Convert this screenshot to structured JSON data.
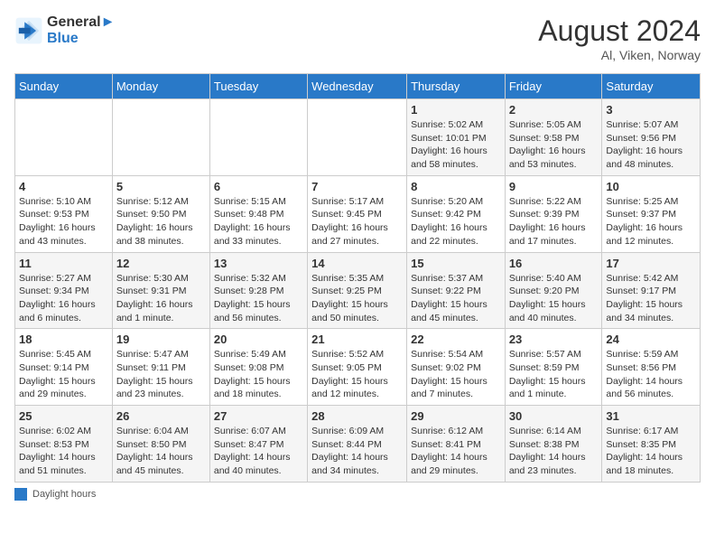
{
  "header": {
    "logo_line1": "General",
    "logo_line2": "Blue",
    "month_title": "August 2024",
    "location": "Al, Viken, Norway"
  },
  "days_of_week": [
    "Sunday",
    "Monday",
    "Tuesday",
    "Wednesday",
    "Thursday",
    "Friday",
    "Saturday"
  ],
  "weeks": [
    [
      {
        "day": "",
        "info": ""
      },
      {
        "day": "",
        "info": ""
      },
      {
        "day": "",
        "info": ""
      },
      {
        "day": "",
        "info": ""
      },
      {
        "day": "1",
        "info": "Sunrise: 5:02 AM\nSunset: 10:01 PM\nDaylight: 16 hours\nand 58 minutes."
      },
      {
        "day": "2",
        "info": "Sunrise: 5:05 AM\nSunset: 9:58 PM\nDaylight: 16 hours\nand 53 minutes."
      },
      {
        "day": "3",
        "info": "Sunrise: 5:07 AM\nSunset: 9:56 PM\nDaylight: 16 hours\nand 48 minutes."
      }
    ],
    [
      {
        "day": "4",
        "info": "Sunrise: 5:10 AM\nSunset: 9:53 PM\nDaylight: 16 hours\nand 43 minutes."
      },
      {
        "day": "5",
        "info": "Sunrise: 5:12 AM\nSunset: 9:50 PM\nDaylight: 16 hours\nand 38 minutes."
      },
      {
        "day": "6",
        "info": "Sunrise: 5:15 AM\nSunset: 9:48 PM\nDaylight: 16 hours\nand 33 minutes."
      },
      {
        "day": "7",
        "info": "Sunrise: 5:17 AM\nSunset: 9:45 PM\nDaylight: 16 hours\nand 27 minutes."
      },
      {
        "day": "8",
        "info": "Sunrise: 5:20 AM\nSunset: 9:42 PM\nDaylight: 16 hours\nand 22 minutes."
      },
      {
        "day": "9",
        "info": "Sunrise: 5:22 AM\nSunset: 9:39 PM\nDaylight: 16 hours\nand 17 minutes."
      },
      {
        "day": "10",
        "info": "Sunrise: 5:25 AM\nSunset: 9:37 PM\nDaylight: 16 hours\nand 12 minutes."
      }
    ],
    [
      {
        "day": "11",
        "info": "Sunrise: 5:27 AM\nSunset: 9:34 PM\nDaylight: 16 hours\nand 6 minutes."
      },
      {
        "day": "12",
        "info": "Sunrise: 5:30 AM\nSunset: 9:31 PM\nDaylight: 16 hours\nand 1 minute."
      },
      {
        "day": "13",
        "info": "Sunrise: 5:32 AM\nSunset: 9:28 PM\nDaylight: 15 hours\nand 56 minutes."
      },
      {
        "day": "14",
        "info": "Sunrise: 5:35 AM\nSunset: 9:25 PM\nDaylight: 15 hours\nand 50 minutes."
      },
      {
        "day": "15",
        "info": "Sunrise: 5:37 AM\nSunset: 9:22 PM\nDaylight: 15 hours\nand 45 minutes."
      },
      {
        "day": "16",
        "info": "Sunrise: 5:40 AM\nSunset: 9:20 PM\nDaylight: 15 hours\nand 40 minutes."
      },
      {
        "day": "17",
        "info": "Sunrise: 5:42 AM\nSunset: 9:17 PM\nDaylight: 15 hours\nand 34 minutes."
      }
    ],
    [
      {
        "day": "18",
        "info": "Sunrise: 5:45 AM\nSunset: 9:14 PM\nDaylight: 15 hours\nand 29 minutes."
      },
      {
        "day": "19",
        "info": "Sunrise: 5:47 AM\nSunset: 9:11 PM\nDaylight: 15 hours\nand 23 minutes."
      },
      {
        "day": "20",
        "info": "Sunrise: 5:49 AM\nSunset: 9:08 PM\nDaylight: 15 hours\nand 18 minutes."
      },
      {
        "day": "21",
        "info": "Sunrise: 5:52 AM\nSunset: 9:05 PM\nDaylight: 15 hours\nand 12 minutes."
      },
      {
        "day": "22",
        "info": "Sunrise: 5:54 AM\nSunset: 9:02 PM\nDaylight: 15 hours\nand 7 minutes."
      },
      {
        "day": "23",
        "info": "Sunrise: 5:57 AM\nSunset: 8:59 PM\nDaylight: 15 hours\nand 1 minute."
      },
      {
        "day": "24",
        "info": "Sunrise: 5:59 AM\nSunset: 8:56 PM\nDaylight: 14 hours\nand 56 minutes."
      }
    ],
    [
      {
        "day": "25",
        "info": "Sunrise: 6:02 AM\nSunset: 8:53 PM\nDaylight: 14 hours\nand 51 minutes."
      },
      {
        "day": "26",
        "info": "Sunrise: 6:04 AM\nSunset: 8:50 PM\nDaylight: 14 hours\nand 45 minutes."
      },
      {
        "day": "27",
        "info": "Sunrise: 6:07 AM\nSunset: 8:47 PM\nDaylight: 14 hours\nand 40 minutes."
      },
      {
        "day": "28",
        "info": "Sunrise: 6:09 AM\nSunset: 8:44 PM\nDaylight: 14 hours\nand 34 minutes."
      },
      {
        "day": "29",
        "info": "Sunrise: 6:12 AM\nSunset: 8:41 PM\nDaylight: 14 hours\nand 29 minutes."
      },
      {
        "day": "30",
        "info": "Sunrise: 6:14 AM\nSunset: 8:38 PM\nDaylight: 14 hours\nand 23 minutes."
      },
      {
        "day": "31",
        "info": "Sunrise: 6:17 AM\nSunset: 8:35 PM\nDaylight: 14 hours\nand 18 minutes."
      }
    ]
  ],
  "footer": {
    "legend_label": "Daylight hours"
  }
}
